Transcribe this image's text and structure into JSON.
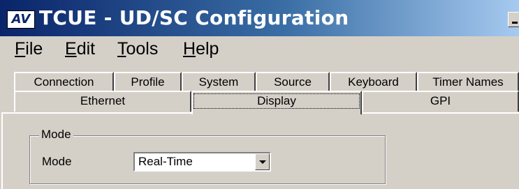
{
  "window": {
    "logo_text": "AV",
    "title": "TCUE - UD/SC Configuration"
  },
  "menu": [
    {
      "mnemonic": "F",
      "rest": "ile"
    },
    {
      "mnemonic": "E",
      "rest": "dit"
    },
    {
      "mnemonic": "T",
      "rest": "ools"
    },
    {
      "mnemonic": "H",
      "rest": "elp"
    }
  ],
  "tabs_back": [
    "Connection",
    "Profile",
    "System",
    "Source",
    "Keyboard",
    "Timer Names"
  ],
  "tabs_front": [
    "Ethernet",
    "Display",
    "GPI"
  ],
  "active_tab": "Display",
  "mode_group": {
    "legend": "Mode",
    "label": "Mode",
    "value": "Real-Time"
  }
}
